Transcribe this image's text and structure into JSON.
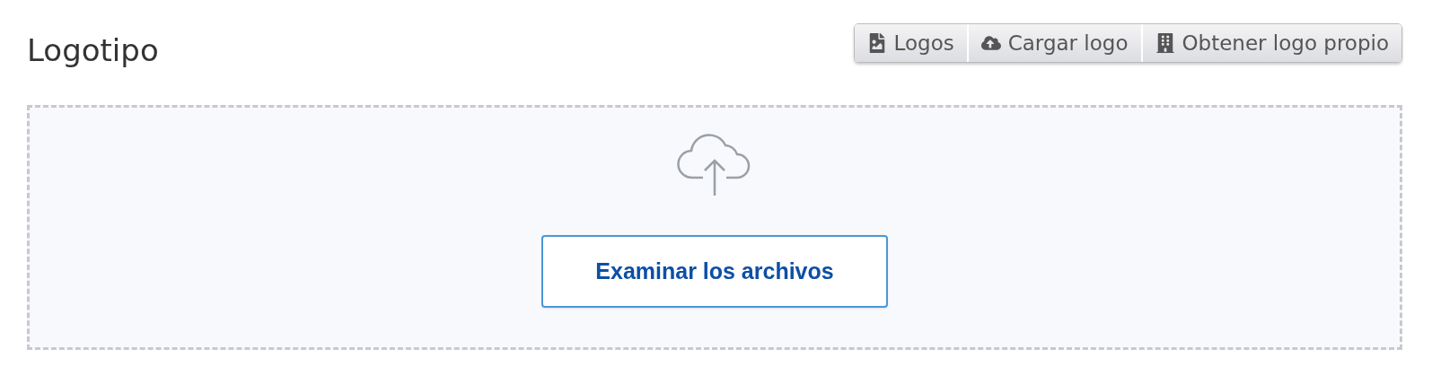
{
  "title": "Logotipo",
  "toolbar": [
    {
      "kind": "image",
      "label": "Logos"
    },
    {
      "kind": "upload",
      "label": "Cargar logo"
    },
    {
      "kind": "building",
      "label": "Obtener logo propio"
    }
  ],
  "dropzone": {
    "button": "Examinar los archivos"
  }
}
